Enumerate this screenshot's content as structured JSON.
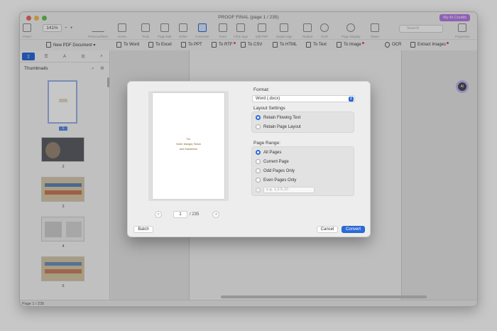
{
  "window": {
    "title": "PROOF FINAL (page 1 / 235)",
    "ai_credits": "My AI Credits",
    "colors": {
      "accent": "#2c6bd9",
      "ai": "#b97be8"
    }
  },
  "toolbar": {
    "zoom_value": "141%",
    "zoom_minus": "−",
    "zoom_plus": "+",
    "search_placeholder": "Search",
    "tools": [
      {
        "label": "Panel",
        "icon": "panel-icon"
      },
      {
        "label": "Zoom",
        "icon": "zoom-icon"
      },
      {
        "label": "Previous/Next",
        "icon": "arrows-icon"
      },
      {
        "label": "Home",
        "icon": "home-icon"
      },
      {
        "label": "Tools",
        "icon": "toolbox-icon"
      },
      {
        "label": "Page Edit",
        "icon": "grid-icon"
      },
      {
        "label": "Editor",
        "icon": "edit-icon"
      },
      {
        "label": "Converter",
        "icon": "converter-icon"
      },
      {
        "label": "Form",
        "icon": "form-icon"
      },
      {
        "label": "Fill & Sign",
        "icon": "sign-icon"
      },
      {
        "label": "Edit PDF",
        "icon": "edit-pdf-icon"
      },
      {
        "label": "Digital Sign",
        "icon": "pen-icon"
      },
      {
        "label": "Redact",
        "icon": "redact-icon"
      },
      {
        "label": "OCR",
        "icon": "ocr-icon"
      },
      {
        "label": "Page Display",
        "icon": "eye-icon"
      },
      {
        "label": "Share",
        "icon": "share-icon"
      },
      {
        "label": "Search",
        "icon": "search-icon"
      },
      {
        "label": "Properties",
        "icon": "properties-icon"
      }
    ]
  },
  "convert_bar": [
    {
      "label": "New PDF Document ▾",
      "icon": "new-doc-icon",
      "badge": false
    },
    {
      "label": "To Word",
      "icon": "word-icon",
      "badge": false
    },
    {
      "label": "To Excel",
      "icon": "excel-icon",
      "badge": false
    },
    {
      "label": "To PPT",
      "icon": "ppt-icon",
      "badge": false
    },
    {
      "label": "To RTF",
      "icon": "rtf-icon",
      "badge": true
    },
    {
      "label": "To CSV",
      "icon": "csv-icon",
      "badge": false
    },
    {
      "label": "To HTML",
      "icon": "html-icon",
      "badge": false
    },
    {
      "label": "To Text",
      "icon": "text-icon",
      "badge": false
    },
    {
      "label": "To Image",
      "icon": "image-icon",
      "badge": true
    },
    {
      "label": "OCR",
      "icon": "ocr-icon",
      "badge": false
    },
    {
      "label": "Extract Images",
      "icon": "extract-icon",
      "badge": true
    }
  ],
  "sidebar": {
    "heading": "Thumbnails",
    "page_numbers": [
      "1",
      "2",
      "3",
      "4",
      "5"
    ]
  },
  "status": {
    "text": "Page 1 / 235"
  },
  "dialog": {
    "preview_lines": [
      "For",
      "Violet, Marigot, Simon",
      "and Grandmom"
    ],
    "current_page": "1",
    "total_pages": "/ 235",
    "prev_label": "‹",
    "next_label": "›",
    "format_label": "Format:",
    "format_value": "Word (.docx)",
    "layout_label": "Layout Settings",
    "layout_options": [
      {
        "label": "Retain Flowing Text",
        "selected": true
      },
      {
        "label": "Retain Page Layout",
        "selected": false
      }
    ],
    "range_label": "Page Range:",
    "range_options": [
      {
        "label": "All Pages",
        "selected": true
      },
      {
        "label": "Current Page",
        "selected": false
      },
      {
        "label": "Odd Pages Only",
        "selected": false
      },
      {
        "label": "Even Pages Only",
        "selected": false
      }
    ],
    "custom_range_placeholder": "e.g. 1,3-5,10",
    "batch_label": "Batch",
    "cancel_label": "Cancel",
    "convert_label": "Convert"
  }
}
